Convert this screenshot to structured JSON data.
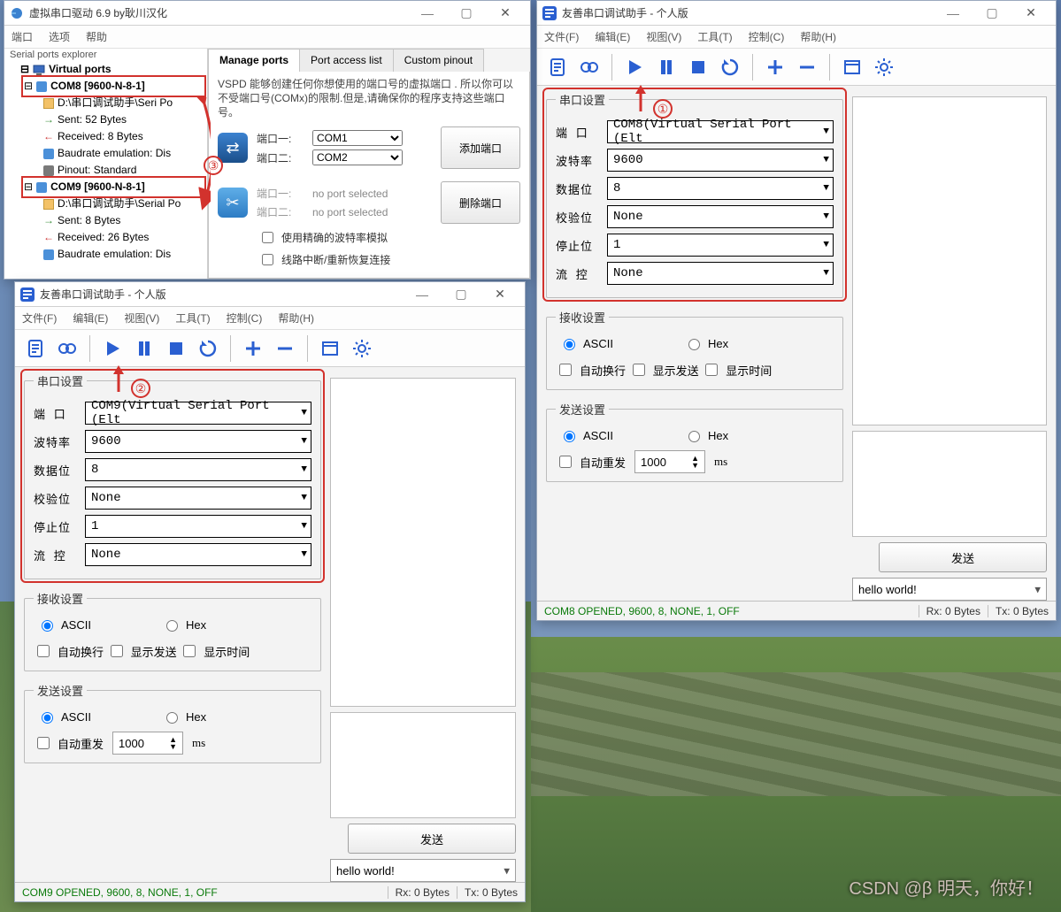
{
  "vspd": {
    "title": "虚拟串口驱动 6.9 by耿川汉化",
    "menu": [
      "端口",
      "选项",
      "帮助"
    ],
    "explorer_label": "Serial ports explorer",
    "tree": {
      "root": "Virtual ports",
      "com8": "COM8 [9600-N-8-1]",
      "com8_items": [
        "D:\\串口调试助手\\Seri Po",
        "Sent: 52 Bytes",
        "Received: 8 Bytes",
        "Baudrate emulation: Dis",
        "Pinout: Standard"
      ],
      "com9": "COM9 [9600-N-8-1]",
      "com9_items": [
        "D:\\串口调试助手\\Serial Po",
        "Sent: 8 Bytes",
        "Received: 26 Bytes",
        "Baudrate emulation: Dis"
      ]
    },
    "tabs": [
      "Manage ports",
      "Port access list",
      "Custom pinout"
    ],
    "desc": "VSPD 能够创建任何你想使用的端口号的虚拟端口 . 所以你可以不受端口号(COMx)的限制.但是,请确保你的程序支持这些端口号。",
    "pair1_l1": "端口一:",
    "pair1_v1": "COM1",
    "pair1_l2": "端口二:",
    "pair1_v2": "COM2",
    "pair1_btn": "添加端口",
    "pair2_l1": "端口一:",
    "pair2_v1": "no port selected",
    "pair2_l2": "端口二:",
    "pair2_v2": "no port selected",
    "pair2_btn": "删除端口",
    "chk1": "使用精确的波特率模拟",
    "chk2": "线路中断/重新恢复连接"
  },
  "helper": {
    "title": "友善串口调试助手 - 个人版",
    "menu": [
      "文件(F)",
      "编辑(E)",
      "视图(V)",
      "工具(T)",
      "控制(C)",
      "帮助(H)"
    ],
    "fs_port": "串口设置",
    "fs_recv": "接收设置",
    "fs_send": "发送设置",
    "labels": {
      "port": "端  口",
      "baud": "波特率",
      "data": "数据位",
      "parity": "校验位",
      "stop": "停止位",
      "flow": "流  控",
      "ascii": "ASCII",
      "hex": "Hex",
      "wrap": "自动换行",
      "showtx": "显示发送",
      "showtime": "显示时间",
      "autoresend": "自动重发",
      "ms": "ms"
    },
    "resend_value": "1000",
    "send_btn": "发送",
    "preset": "hello world!"
  },
  "left": {
    "port": "COM9(Virtual Serial Port (Elt",
    "baud": "9600",
    "data": "8",
    "parity": "None",
    "stop": "1",
    "flow": "None",
    "status": "COM9 OPENED, 9600, 8, NONE, 1, OFF",
    "rx": "Rx: 0 Bytes",
    "tx": "Tx: 0 Bytes"
  },
  "right": {
    "port": "COM8(Virtual Serial Port (Elt",
    "baud": "9600",
    "data": "8",
    "parity": "None",
    "stop": "1",
    "flow": "None",
    "status": "COM8 OPENED, 9600, 8, NONE, 1, OFF",
    "rx": "Rx: 0 Bytes",
    "tx": "Tx: 0 Bytes"
  },
  "annotations": {
    "n1": "①",
    "n2": "②",
    "n3": "③"
  },
  "watermark": "CSDN @β 明天，你好！"
}
